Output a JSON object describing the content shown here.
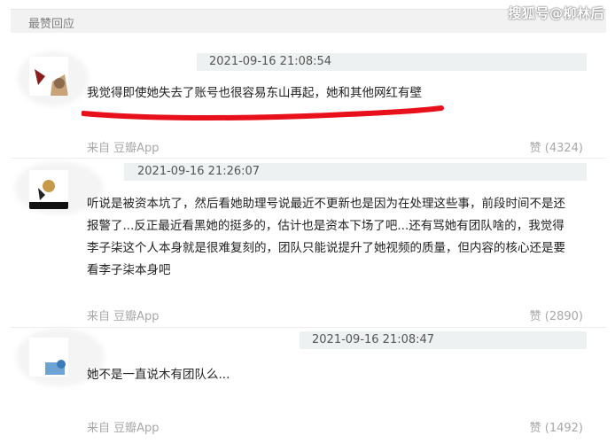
{
  "header": {
    "title": "最赞回应",
    "watermark": "搜狐号@柳林后"
  },
  "comments": [
    {
      "timestamp": "2021-09-16 21:08:54",
      "text": "我觉得即使她失去了账号也很容易东山再起，她和其他网红有壁",
      "source": "来自 豆瓣App",
      "likes": "赞 (4324)",
      "highlight_color": "#e8101a"
    },
    {
      "timestamp": "2021-09-16 21:26:07",
      "text_lines": [
        "听说是被资本坑了，然后看她助理号说最近不更新也是因为在处理这些事，前段时间不是还",
        "报警了...反正最近看黑她的挺多的，估计也是资本下场了吧...还有骂她有团队啥的，我觉得",
        "李子柒这个人本身就是很难复刻的，团队只能说提升了她视频的质量，但内容的核心还是要",
        "看李子柒本身吧"
      ],
      "source": "来自 豆瓣App",
      "likes": "赞 (2890)"
    },
    {
      "timestamp": "2021-09-16 21:08:47",
      "text": "她不是一直说木有团队么...",
      "source": "来自 豆瓣App",
      "likes": "赞 (1492)"
    }
  ]
}
